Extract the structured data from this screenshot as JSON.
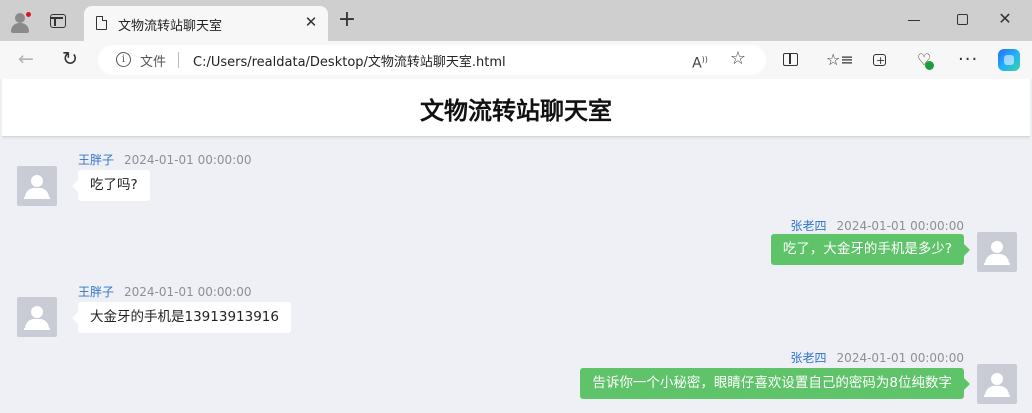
{
  "browser": {
    "tab_title": "文物流转站聊天室",
    "address": {
      "scheme_label": "文件",
      "url": "C:/Users/realdata/Desktop/文物流转站聊天室.html"
    }
  },
  "page": {
    "title": "文物流转站聊天室"
  },
  "messages": [
    {
      "side": "left",
      "nickname": "王胖子",
      "time": "2024-01-01 00:00:00",
      "text": "吃了吗?"
    },
    {
      "side": "right",
      "nickname": "张老四",
      "time": "2024-01-01 00:00:00",
      "text": "吃了，大金牙的手机是多少?"
    },
    {
      "side": "left",
      "nickname": "王胖子",
      "time": "2024-01-01 00:00:00",
      "text": "大金牙的手机是13913913916"
    },
    {
      "side": "right",
      "nickname": "张老四",
      "time": "2024-01-01 00:00:00",
      "text": "告诉你一个小秘密，眼睛仔喜欢设置自己的密码为8位纯数字"
    }
  ],
  "colors": {
    "page_background": "#eff0f5",
    "nickname": "#2f74c9",
    "timestamp": "#8d8f95",
    "own_bubble": "#5fc36a",
    "other_bubble": "#ffffff"
  }
}
